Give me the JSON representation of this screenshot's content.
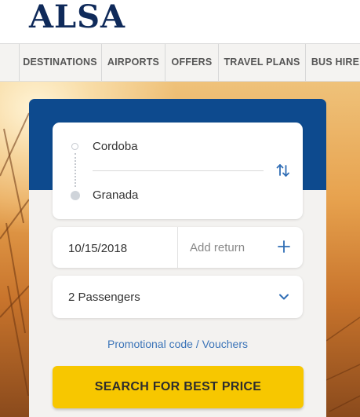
{
  "brand": {
    "name": "ALSA"
  },
  "nav": {
    "items": [
      {
        "label": "DESTINATIONS"
      },
      {
        "label": "AIRPORTS"
      },
      {
        "label": "OFFERS"
      },
      {
        "label": "TRAVEL PLANS"
      },
      {
        "label": "BUS HIRE"
      }
    ]
  },
  "search": {
    "origin": "Cordoba",
    "destination": "Granada",
    "departure_date": "10/15/2018",
    "return_placeholder": "Add return",
    "passengers": "2 Passengers",
    "promo_link": "Promotional code / Vouchers",
    "submit_label": "SEARCH FOR BEST PRICE"
  },
  "colors": {
    "brand_navy": "#0f2a5a",
    "card_header_blue": "#0d4a8e",
    "accent_blue": "#3b74b8",
    "button_yellow": "#f7c700"
  },
  "icons": {
    "swap": "swap-vertical-arrows-icon",
    "add_return": "plus-icon",
    "passengers_dropdown": "chevron-down-icon"
  }
}
